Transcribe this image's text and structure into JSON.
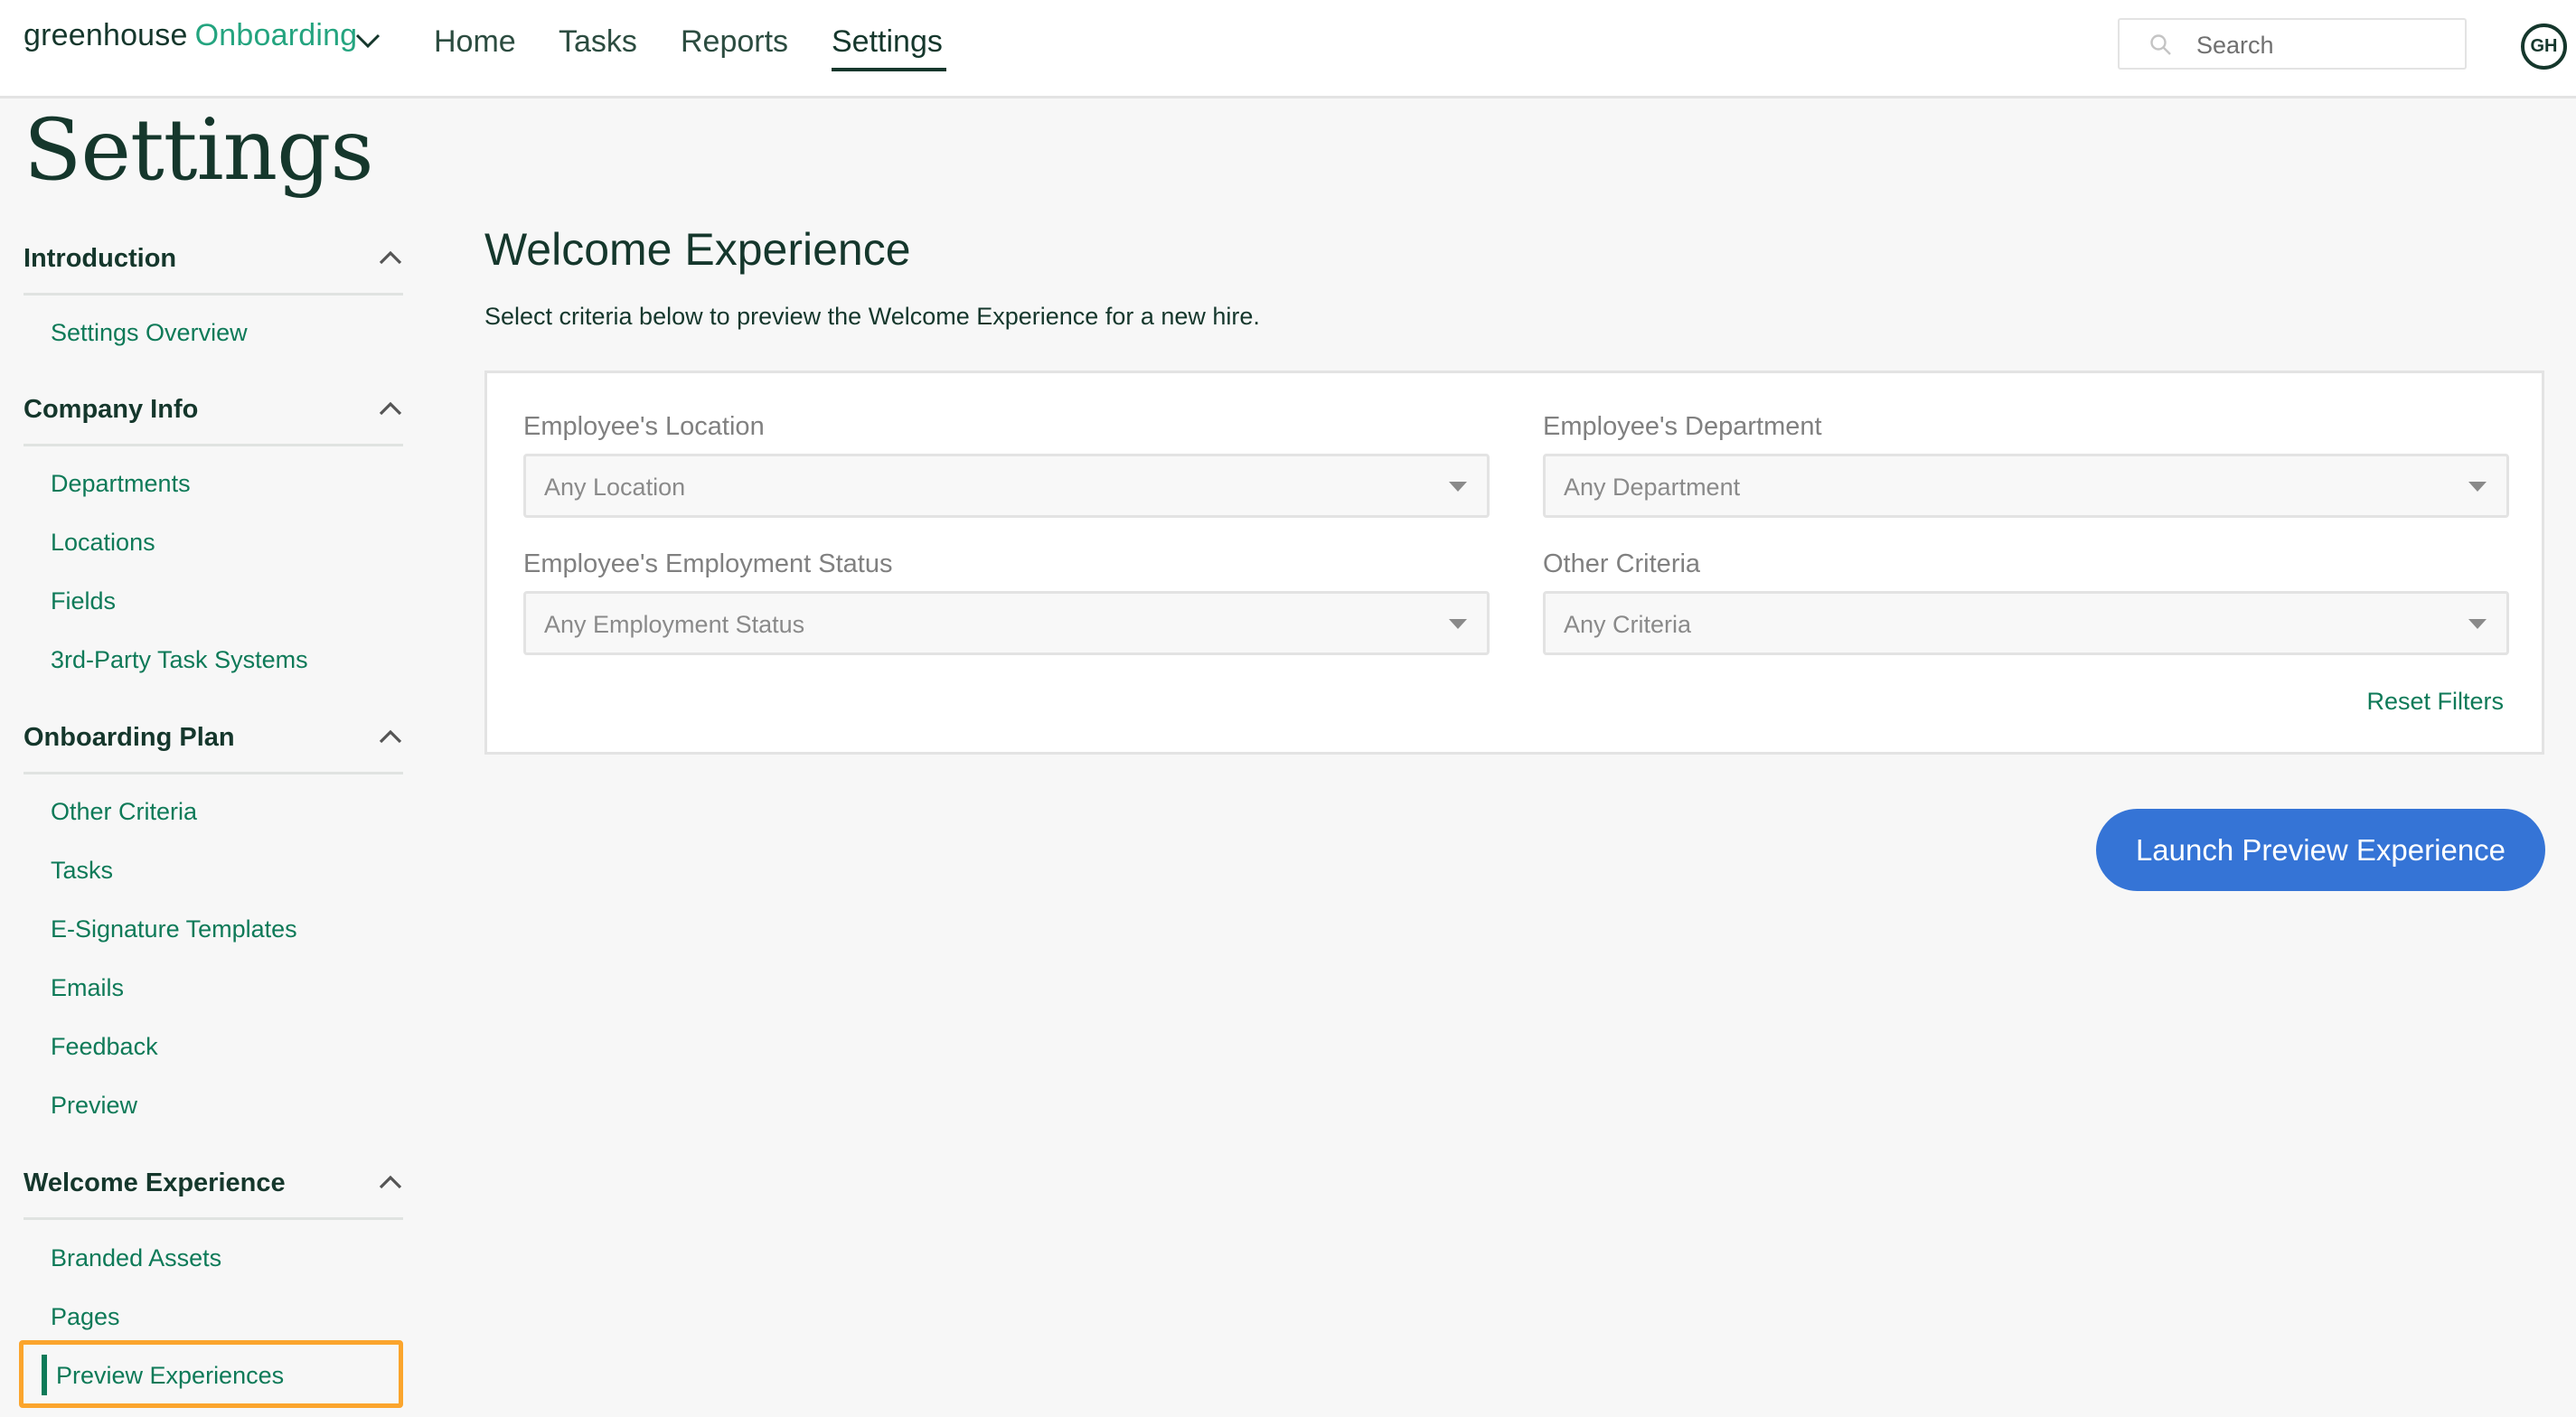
{
  "header": {
    "logo_primary": "greenhouse",
    "logo_secondary": "Onboarding",
    "nav": [
      {
        "label": "Home",
        "active": false
      },
      {
        "label": "Tasks",
        "active": false
      },
      {
        "label": "Reports",
        "active": false
      },
      {
        "label": "Settings",
        "active": true
      }
    ],
    "search": {
      "placeholder": "Search",
      "value": ""
    },
    "avatar_initials": "GH"
  },
  "page_title": "Settings",
  "sidebar": {
    "sections": [
      {
        "title": "Introduction",
        "expanded": true,
        "items": [
          "Settings Overview"
        ]
      },
      {
        "title": "Company Info",
        "expanded": true,
        "items": [
          "Departments",
          "Locations",
          "Fields",
          "3rd-Party Task Systems"
        ]
      },
      {
        "title": "Onboarding Plan",
        "expanded": true,
        "items": [
          "Other Criteria",
          "Tasks",
          "E-Signature Templates",
          "Emails",
          "Feedback",
          "Preview"
        ]
      },
      {
        "title": "Welcome Experience",
        "expanded": true,
        "items": [
          "Branded Assets",
          "Pages",
          "Preview Experiences"
        ]
      }
    ],
    "active_item": "Preview Experiences"
  },
  "main": {
    "title": "Welcome Experience",
    "subtitle": "Select criteria below to preview the Welcome Experience for a new hire.",
    "filters": [
      {
        "label": "Employee's Location",
        "value": "Any Location"
      },
      {
        "label": "Employee's Department",
        "value": "Any Department"
      },
      {
        "label": "Employee's Employment Status",
        "value": "Any Employment Status"
      },
      {
        "label": "Other Criteria",
        "value": "Any Criteria"
      }
    ],
    "reset_label": "Reset Filters",
    "launch_label": "Launch Preview Experience"
  },
  "colors": {
    "brand_dark": "#15372c",
    "brand_green": "#24a47f",
    "link_green": "#0e7a58",
    "primary_button": "#3574d6",
    "highlight_outline": "#fba52d"
  }
}
